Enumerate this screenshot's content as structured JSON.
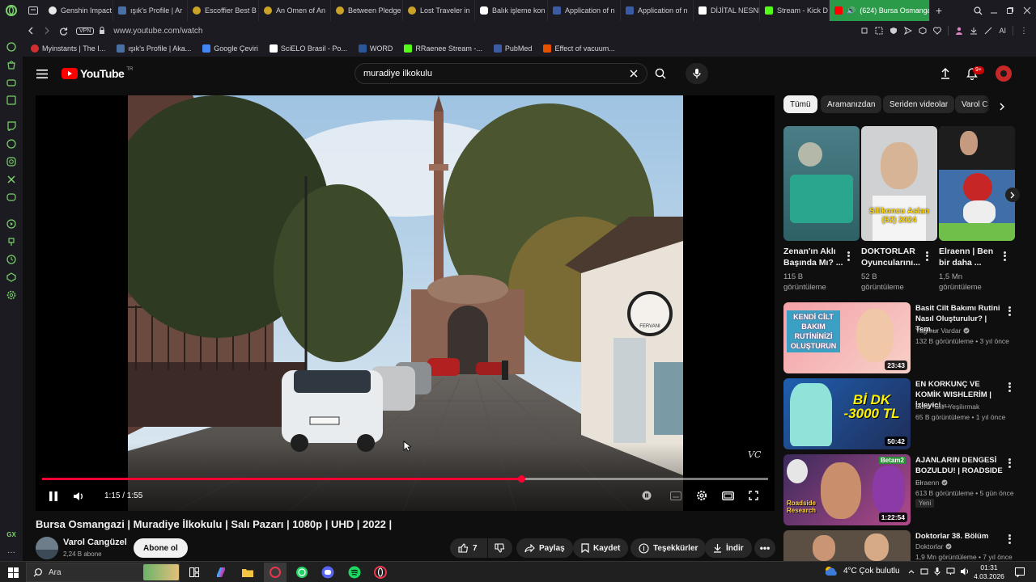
{
  "browser": {
    "tabs": [
      {
        "label": "Genshin Impact",
        "color": "#e8e8e8"
      },
      {
        "label": "ışık's Profile | Ar",
        "color": "#4a6fa5"
      },
      {
        "label": "Escoffier Best B",
        "color": "#c9a227"
      },
      {
        "label": "An Omen of An",
        "color": "#c9a227"
      },
      {
        "label": "Between Pledge",
        "color": "#c9a227"
      },
      {
        "label": "Lost Traveler in",
        "color": "#c9a227"
      },
      {
        "label": "Balık işleme kon",
        "color": "#ffffff"
      },
      {
        "label": "Application of n",
        "color": "#3b5ba5"
      },
      {
        "label": "Application of n",
        "color": "#3b5ba5"
      },
      {
        "label": "DİJİTAL NESNE",
        "color": "#ffffff"
      },
      {
        "label": "Stream - Kick D",
        "color": "#53fc18"
      },
      {
        "label": "(624) Bursa Osmangaz",
        "color": "#ff0000",
        "active": true
      }
    ],
    "url": "www.youtube.com/watch",
    "vpn_label": "VPN",
    "ai_label": "AI",
    "bookmarks": [
      {
        "label": "Myinstants | The I...",
        "color": "#d32f2f"
      },
      {
        "label": "ışık's Profile | Aka...",
        "color": "#4a6fa5"
      },
      {
        "label": "Google Çeviri",
        "color": "#4285f4"
      },
      {
        "label": "SciELO Brasil - Po...",
        "color": "#ffffff"
      },
      {
        "label": "WORD",
        "color": "#2b579a"
      },
      {
        "label": "RRaenee Stream -...",
        "color": "#53fc18"
      },
      {
        "label": "PubMed",
        "color": "#3b5ba5"
      },
      {
        "label": "Effect of vacuum...",
        "color": "#e65100"
      }
    ]
  },
  "youtube": {
    "logo_text": "YouTube",
    "region": "TR",
    "search_value": "muradiye ilkokulu",
    "notification_badge": "9+",
    "chips": [
      "Tümü",
      "Aramanızdan",
      "Seriden videolar",
      "Varol C"
    ],
    "player": {
      "time": "1:15 / 1:55",
      "progress": 0.66,
      "buffered": 1.0,
      "watermark": "VC",
      "sign_text": "FERVANI"
    },
    "video": {
      "title": "Bursa Osmangazi | Muradiye İlkokulu | Salı Pazarı | 1080p | UHD | 2022 |",
      "channel": "Varol Cangüzel",
      "subscribers": "2,24 B abone",
      "subscribe_label": "Abone ol",
      "likes": "7",
      "share_label": "Paylaş",
      "save_label": "Kaydet",
      "thanks_label": "Teşekkürler",
      "download_label": "İndir"
    },
    "shorts": [
      {
        "title": "Zenan'ın Aklı Başında Mı? ...",
        "views": "115 B",
        "views_unit": "görüntüleme"
      },
      {
        "title": "DOKTORLAR Oyuncularını...",
        "views": "52 B",
        "views_unit": "görüntüleme",
        "overlay": "Silikoncu Aslan (52) 2024"
      },
      {
        "title": "Elraenn | Ben bir daha ...",
        "views": "1,5 Mn",
        "views_unit": "görüntüleme"
      }
    ],
    "recommended": [
      {
        "title": "Basit Cilt Bakımı Rutini Nasıl Oluşturulur? | Tem...",
        "channel": "Yağmur Vardar",
        "meta": "132 B görüntüleme • 3 yıl önce",
        "duration": "23:43",
        "thumb_text": "KENDİ CİLT BAKIM RUTİNİNİZİ OLUŞTURUN",
        "verified": true
      },
      {
        "title": "EN KORKUNÇ VE KOMİK WISHLERİM | İzleyici ...",
        "channel": "Bora \"Slit\" Yeşilırmak",
        "meta": "65 B görüntüleme • 1 yıl önce",
        "duration": "50:42",
        "thumb_text": "Bİ DK -3000 TL",
        "verified": false
      },
      {
        "title": "AJANLARIN DENGESİ BOZULDU! | ROADSIDE ...",
        "channel": "Elraenn",
        "meta": "613 B görüntüleme • 5 gün önce",
        "badge": "Yeni",
        "duration": "1:22:54",
        "thumb_text": "Roadside Research",
        "thumb_tag": "Betam2",
        "verified": true
      },
      {
        "title": "Doktorlar 38. Bölüm",
        "channel": "Doktorlar",
        "meta": "1,9 Mn görüntüleme • 7 yıl önce",
        "verified": true
      }
    ]
  },
  "taskbar": {
    "search_placeholder": "Ara",
    "weather": "4°C  Çok bulutlu",
    "time": "01:31",
    "date": "4.03.2026"
  }
}
